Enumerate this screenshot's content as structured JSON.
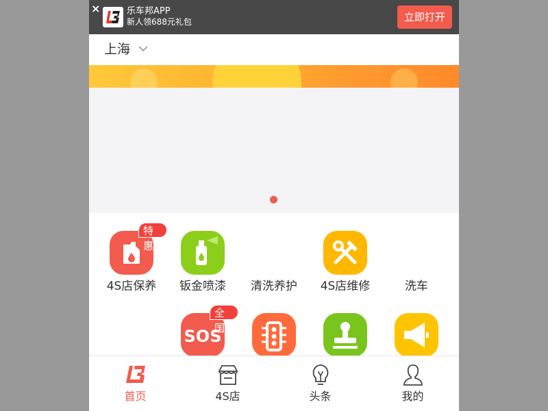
{
  "app_banner": {
    "close": "×",
    "app_name": "乐车邦APP",
    "subtitle": "新人领688元礼包",
    "open_button": "立即打开"
  },
  "header": {
    "city": "上海"
  },
  "carousel": {
    "active_index": 0,
    "dot_color": "#f25b4d"
  },
  "services_row1": [
    {
      "label": "4S店保养",
      "icon": "oil-bottle-icon",
      "tag": "特惠",
      "color": "#f25b4d"
    },
    {
      "label": "钣金喷漆",
      "icon": "spray-can-icon",
      "color": "#8ccf1a"
    },
    {
      "label": "清洗养护",
      "icon": "",
      "color": ""
    },
    {
      "label": "4S店维修",
      "icon": "tools-icon",
      "color": "#ffb800"
    },
    {
      "label": "洗车",
      "icon": "",
      "color": ""
    }
  ],
  "services_row2": [
    {
      "label": "",
      "icon": "",
      "color": ""
    },
    {
      "label": "",
      "icon": "sos-icon",
      "tag": "全国",
      "color": "#f25b4d"
    },
    {
      "label": "",
      "icon": "traffic-light-icon",
      "color": "#ff6a3c"
    },
    {
      "label": "",
      "icon": "stamp-icon",
      "color": "#7ac51d"
    },
    {
      "label": "",
      "icon": "megaphone-icon",
      "color": "#ffc400"
    }
  ],
  "tabbar": [
    {
      "label": "首页",
      "icon": "home-logo-icon",
      "active": true
    },
    {
      "label": "4S店",
      "icon": "store-icon",
      "active": false
    },
    {
      "label": "头条",
      "icon": "lightbulb-icon",
      "active": false
    },
    {
      "label": "我的",
      "icon": "user-icon",
      "active": false
    }
  ],
  "colors": {
    "accent": "#f25b4d",
    "banner_bg": "#484848"
  }
}
